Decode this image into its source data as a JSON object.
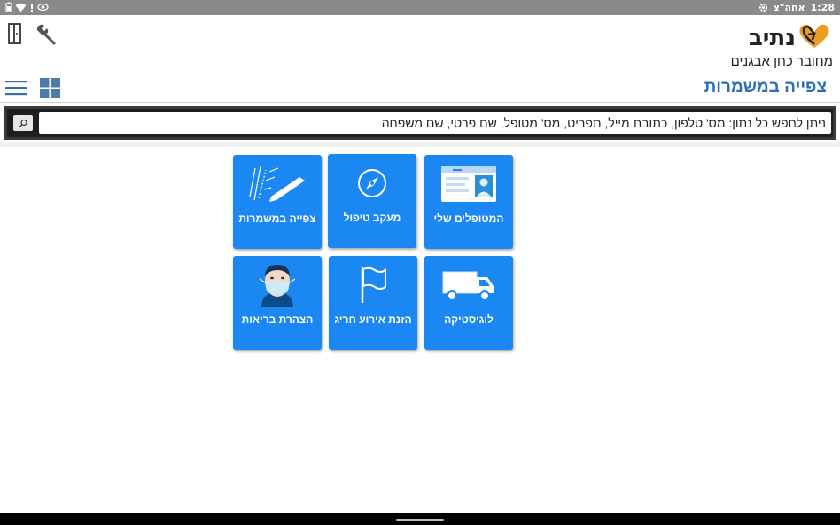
{
  "status_bar": {
    "time": "1:28",
    "date_label": "אחה\"צ",
    "icons": [
      "battery-icon",
      "wifi-icon",
      "location-icon",
      "eye-icon",
      "settings-icon"
    ]
  },
  "header": {
    "logo_text": "נתיב",
    "connected_user": "מחובר כחן אבגנים",
    "page_title": "צפייה במשמרות"
  },
  "search": {
    "placeholder": "ניתן לחפש כל נתון: מס' טלפון, כתובת מייל, תפריט, מס' מטופל, שם פרטי, שם משפחה",
    "button_icon": "search-icon"
  },
  "tiles": [
    {
      "label": "המטופלים שלי",
      "icon": "id-card-icon"
    },
    {
      "label": "מעקב טיפול",
      "icon": "compass-icon"
    },
    {
      "label": "צפייה במשמרות",
      "icon": "clipboard-pen-icon"
    },
    {
      "label": "לוגיסטיקה",
      "icon": "truck-icon"
    },
    {
      "label": "הזנת אירוע חריג",
      "icon": "flag-icon"
    },
    {
      "label": "הצהרת בריאות",
      "icon": "masked-person-icon"
    }
  ],
  "colors": {
    "accent": "#2c6fb5",
    "tile": "#1a87f3",
    "status_bar": "#8a8a8a"
  }
}
